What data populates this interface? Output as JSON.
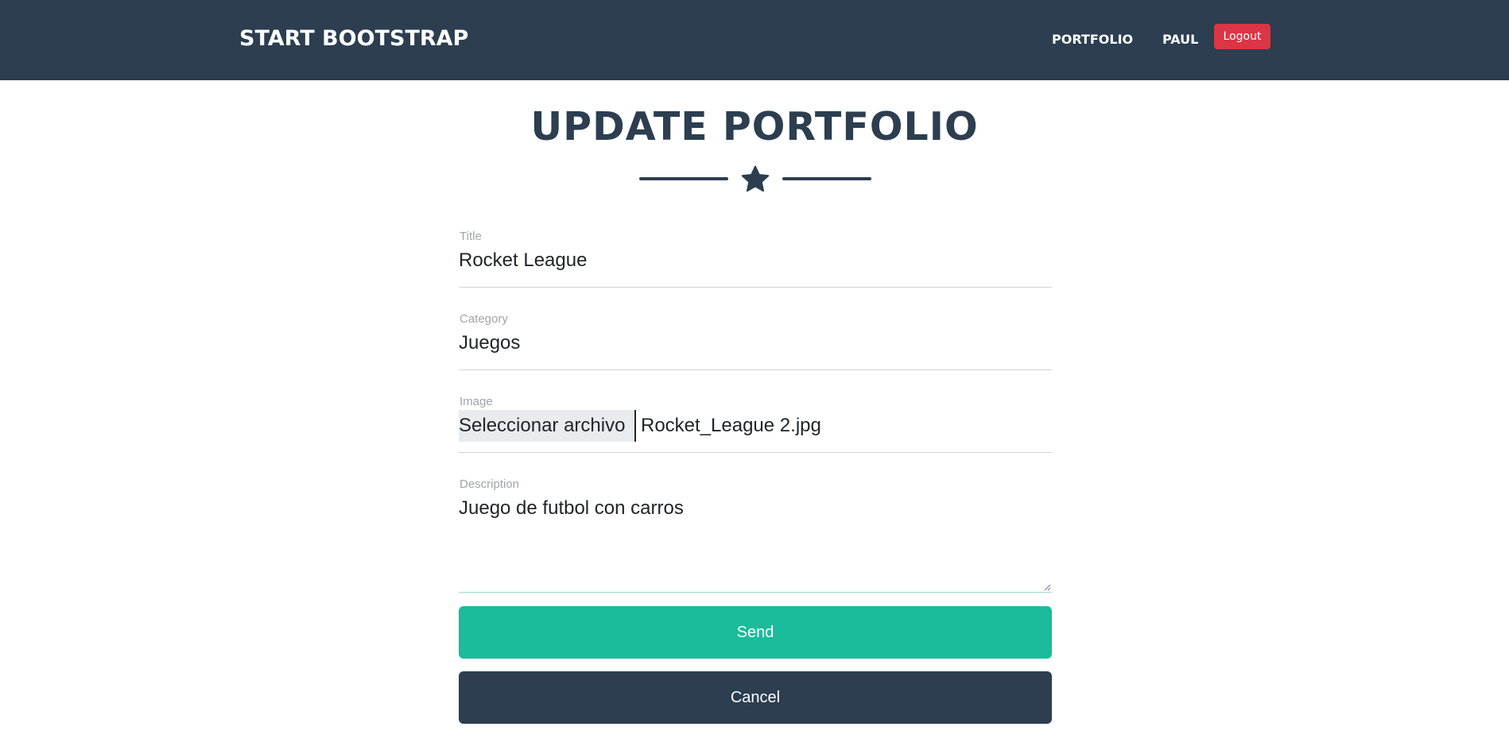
{
  "colors": {
    "nav_bg": "#2c3e50",
    "logout_bg": "#dc3545",
    "send_bg": "#1abc9c",
    "cancel_bg": "#2c3e50",
    "title_color": "#2c3e50"
  },
  "navbar": {
    "brand": "START BOOTSTRAP",
    "portfolio_link": "PORTFOLIO",
    "user_link": "PAUL",
    "logout_label": "Logout"
  },
  "page": {
    "title": "UPDATE PORTFOLIO",
    "divider_icon": "star-icon"
  },
  "form": {
    "title": {
      "label": "Title",
      "value": "Rocket League"
    },
    "category": {
      "label": "Category",
      "value": "Juegos"
    },
    "image": {
      "label": "Image",
      "button_label": "Seleccionar archivo",
      "file_name": "Rocket_League 2.jpg"
    },
    "description": {
      "label": "Description",
      "value": "Juego de futbol con carros"
    },
    "send_label": "Send",
    "cancel_label": "Cancel"
  }
}
